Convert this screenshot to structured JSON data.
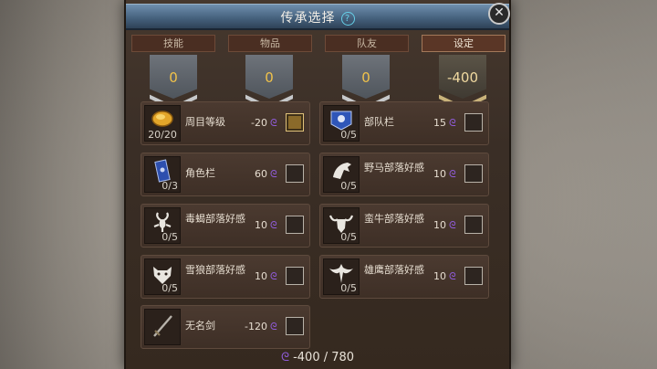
{
  "window": {
    "title": "传承选择"
  },
  "tabs": [
    {
      "label": "技能"
    },
    {
      "label": "物品"
    },
    {
      "label": "队友"
    },
    {
      "label": "设定"
    }
  ],
  "banners": [
    {
      "value": "0"
    },
    {
      "value": "0"
    },
    {
      "value": "0"
    },
    {
      "value": "-400"
    }
  ],
  "items": [
    {
      "name": "周目等级",
      "count": "20/20",
      "cost": "-20",
      "checked": true,
      "icon": "gold-coin-icon"
    },
    {
      "name": "部队栏",
      "count": "0/5",
      "cost": "15",
      "checked": false,
      "icon": "banner-flag-icon"
    },
    {
      "name": "角色栏",
      "count": "0/3",
      "cost": "60",
      "checked": false,
      "icon": "scroll-banner-icon"
    },
    {
      "name": "野马部落好感",
      "count": "0/5",
      "cost": "10",
      "checked": false,
      "icon": "horse-icon"
    },
    {
      "name": "毒蝎部落好感",
      "count": "0/5",
      "cost": "10",
      "checked": false,
      "icon": "scorpion-icon"
    },
    {
      "name": "蛮牛部落好感",
      "count": "0/5",
      "cost": "10",
      "checked": false,
      "icon": "bull-icon"
    },
    {
      "name": "雪狼部落好感",
      "count": "0/5",
      "cost": "10",
      "checked": false,
      "icon": "wolf-icon"
    },
    {
      "name": "雄鹰部落好感",
      "count": "0/5",
      "cost": "10",
      "checked": false,
      "icon": "eagle-icon"
    },
    {
      "name": "无名剑",
      "count": "",
      "cost": "-120",
      "checked": false,
      "icon": "sword-icon"
    }
  ],
  "footer": {
    "total": "-400 / 780"
  },
  "colors": {
    "currency": "#8f5bd8",
    "title_bar": "#47637f",
    "banner_value": "#f0c24a"
  }
}
